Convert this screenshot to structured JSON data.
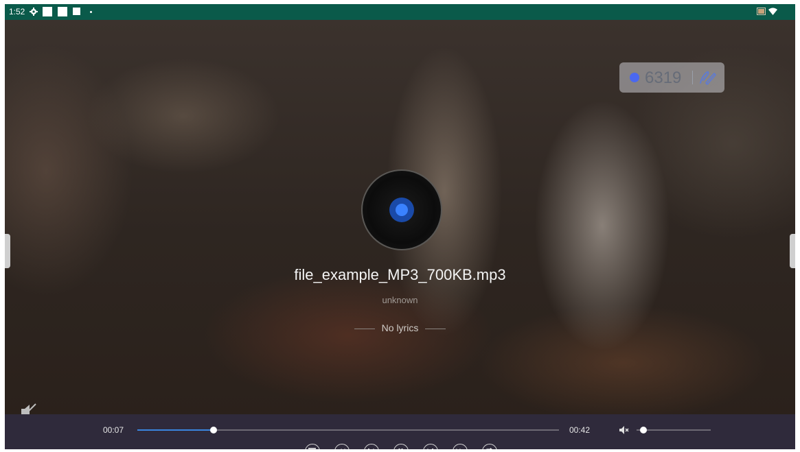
{
  "status_bar": {
    "time": "1:52",
    "icons": [
      "settings-icon",
      "notification-square-icon",
      "notification-square-icon",
      "notification-square-icon",
      "dot-icon",
      "cast-icon",
      "wifi-icon"
    ]
  },
  "badge": {
    "count": "6319",
    "icon": "pen-icon",
    "dot_color": "#4a68f0"
  },
  "track": {
    "title": "file_example_MP3_700KB.mp3",
    "artist": "unknown",
    "lyrics": "No lyrics"
  },
  "player": {
    "current_time": "00:07",
    "total_time": "00:42",
    "progress": 0.18,
    "volume": 0.09,
    "accent_color": "#3a86e0",
    "buttons": [
      "playlist-icon",
      "rewind-icon",
      "previous-icon",
      "pause-icon",
      "next-icon",
      "fast-forward-icon",
      "repeat-icon"
    ]
  }
}
